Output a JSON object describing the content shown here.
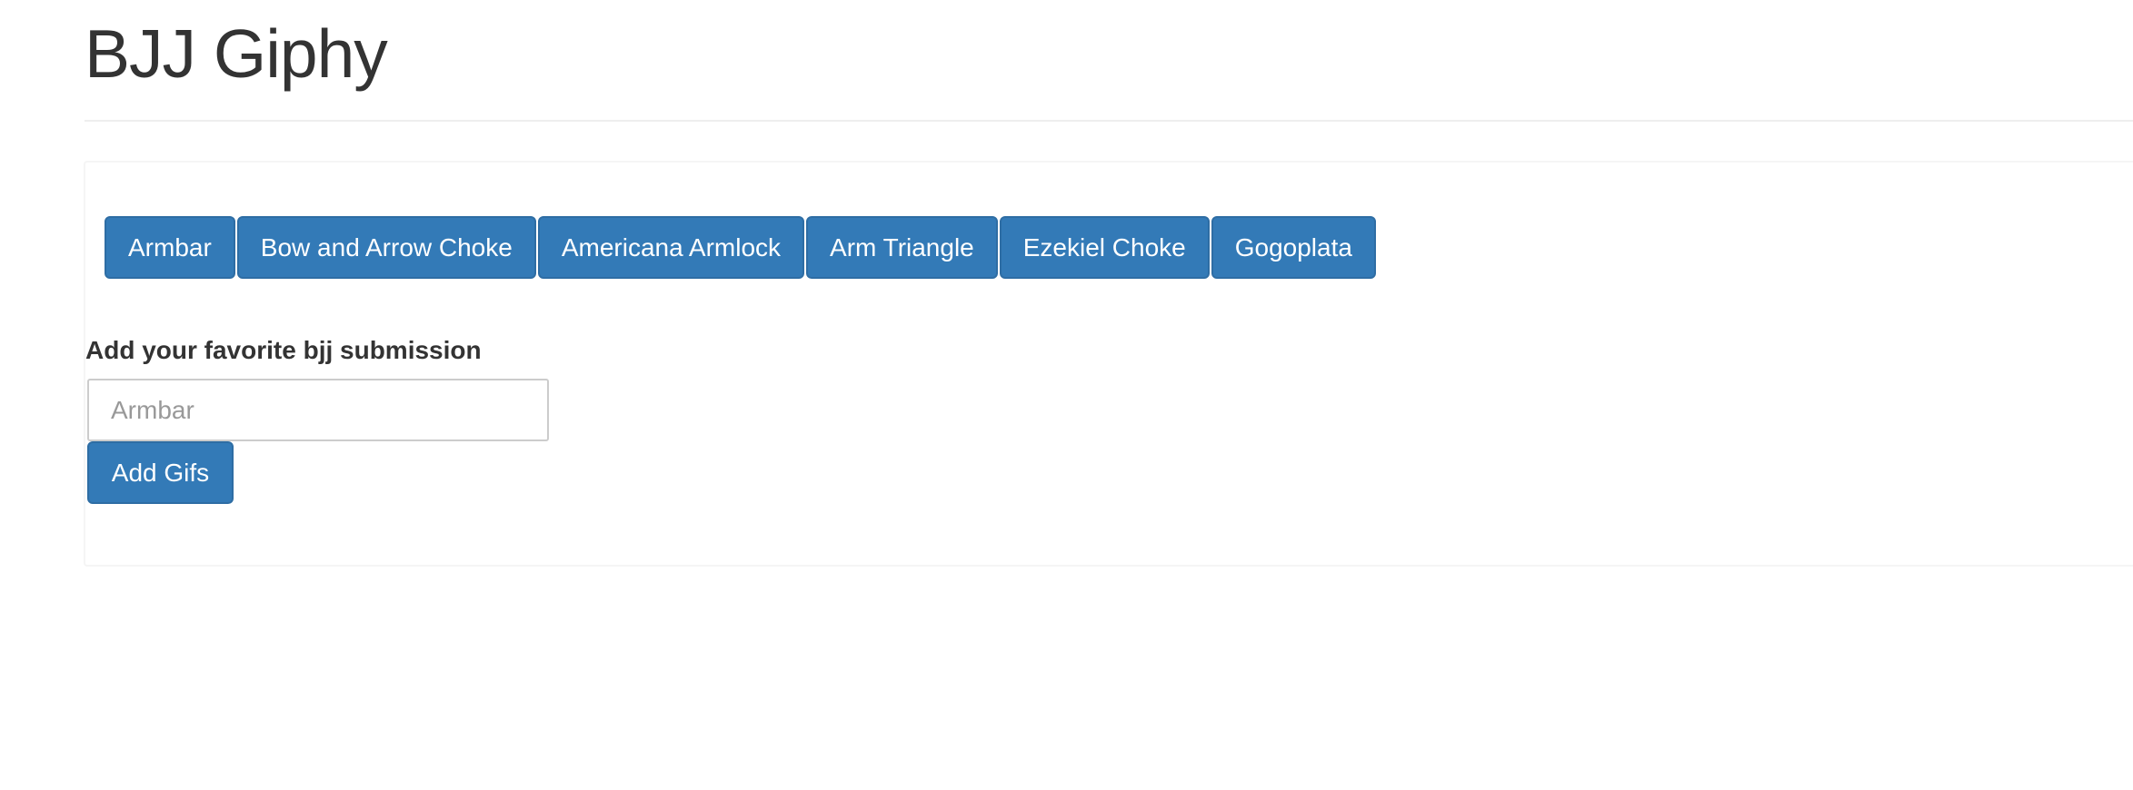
{
  "header": {
    "title": "BJJ Giphy"
  },
  "topics": {
    "buttons": [
      "Armbar",
      "Bow and Arrow Choke",
      "Americana Armlock",
      "Arm Triangle",
      "Ezekiel Choke",
      "Gogoplata"
    ]
  },
  "form": {
    "label": "Add your favorite bjj submission",
    "input_placeholder": "Armbar",
    "input_value": "",
    "submit_label": "Add Gifs"
  },
  "colors": {
    "button_bg": "#337ab7",
    "button_border": "#2e6da4",
    "text": "#333333"
  }
}
